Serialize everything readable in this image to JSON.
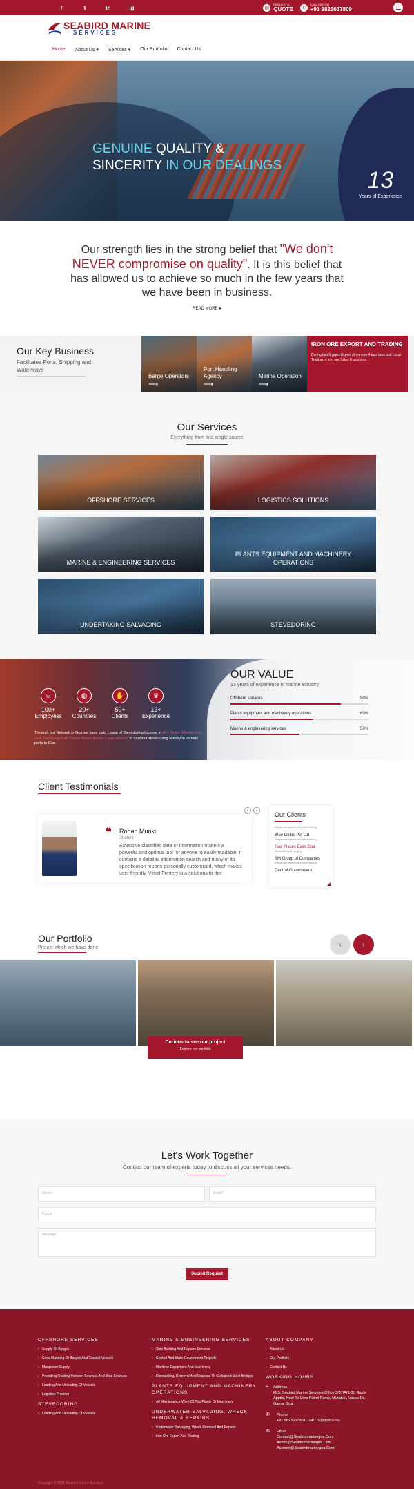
{
  "topbar": {
    "social": [
      "f",
      "t",
      "in",
      "ig"
    ],
    "quote_small": "REQUEST A",
    "quote_big": "QUOTE",
    "call_small": "CALL US NOW",
    "call_big": "+91 9823637809"
  },
  "header": {
    "logo_line1": "SEABIRD MARINE",
    "logo_line2": "SERVICES",
    "nav": [
      "Home",
      "About Us",
      "Services",
      "Our Portfolio",
      "Contact Us"
    ]
  },
  "hero": {
    "line1_a": "GENUINE ",
    "line1_b": "QUALITY &",
    "line2_a": "SINCERITY ",
    "line2_b": "IN OUR DEALINGS",
    "years_num": "13",
    "years_label": "Years of Experience"
  },
  "belief": {
    "p1": "Our strength lies in the strong belief that ",
    "p2": "\"We don't NEVER compromise on quality\"",
    "p3": ". It is this belief that has allowed us to achieve so much in the few years that we have been in business.",
    "read_more": "READ MORE"
  },
  "key_business": {
    "title": "Our Key Business",
    "subtitle": "Facilitates Ports, Shipping and Waterways",
    "tiles": [
      "Barge Operators",
      "Port Handling Agency",
      "Marine Operation"
    ],
    "red_title": "IRON ORE EXPORT AND TRADING",
    "red_text": "During last 5 years Export of iron ore 4 lacs tons and Local Trading of iron ore Sales 8 lacs tons."
  },
  "services": {
    "title": "Our Services",
    "subtitle": "Everything from one single source",
    "items": [
      "OFFSHORE SERVICES",
      "LOGISTICS SOLUTIONS",
      "MARINE & ENGINEERING SERVICES",
      "PLANTS EQUIPMENT AND MACHINERY OPERATIONS",
      "UNDERTAKING SALVAGING",
      "STEVEDORING"
    ]
  },
  "value": {
    "stats": [
      {
        "num": "100+",
        "label": "Employess"
      },
      {
        "num": "20+",
        "label": "Countries"
      },
      {
        "num": "50+",
        "label": "Clients"
      },
      {
        "num": "13+",
        "label": "Experience"
      }
    ],
    "text_a": "Through our Network in Goa we have valid Lease of Stevedoring License in ",
    "text_b": "AKI, Deba, Mhadei  Iron orek  Tiwi  Barge  Lab  Vessel  Mover  Ambia  Cargo Movers",
    "text_c": " to carryout stevedoring activity in various ports in Goa.",
    "title": "OUR VALUE",
    "subtitle": "13 years of experience in marine industry",
    "bars": [
      {
        "label": "Offshore services",
        "pct": "80%",
        "value": 80
      },
      {
        "label": "Plants equipment and machinery operations",
        "pct": "60%",
        "value": 60
      },
      {
        "label": "Marine & engineering services",
        "pct": "50%",
        "value": 50
      }
    ]
  },
  "testimonials": {
    "title": "Client Testimonials",
    "name": "Rohan Munki",
    "role": "Student",
    "text": "Extensive classified data or information make it a powerful and optimal tool for anyone to easily readable. It contains a detailed information search and many of its specification reports personally customised, which makes user-friendly. Vimal Printery is a solutions to this",
    "clients_title": "Our Clients",
    "clients": [
      {
        "name": "",
        "sub": "Barge management & stevedoring"
      },
      {
        "name": "Blue Globe Pvt Ltd",
        "sub": "Barge management & stevedoring"
      },
      {
        "name": "Goa Pisces Exim Goa",
        "sub": "Stevedoring & barging"
      },
      {
        "name": "SM Group of Companies",
        "sub": "Barge management & stevedoring"
      },
      {
        "name": "Central Government",
        "sub": ""
      }
    ]
  },
  "portfolio": {
    "title": "Our Portfolio",
    "subtitle": "Project which we have done",
    "cta_title": "Curious to see our project",
    "cta_sub": "Explore our portfolio"
  },
  "contact": {
    "title": "Let's Work Together",
    "subtitle": "Contact our team of experts today to discuss all your services needs.",
    "name_ph": "Name*",
    "email_ph": "Email*",
    "phone_ph": "Phone",
    "message_ph": "Message",
    "submit": "Submit Request"
  },
  "footer": {
    "col1_h1": "OFFSHORE SERVICES",
    "col1_links": [
      "Supply Of Barges",
      "Crew Manning Of Barges And Coastal Vessels",
      "Manpower Supply",
      "Providing Floating Pontoon Services And Boat Services",
      "Loading And Unloading Of Vessels",
      "Logistics Provider"
    ],
    "col1_h2": "STEVEDORING",
    "col1_links2": [
      "Loading And Unloading Of Vessels"
    ],
    "col2_h1": "MARINE & ENGINEERING SERVICES",
    "col2_links": [
      "Ship Building And Repairs Services",
      "Central And State Government Projects",
      "Maritime Equipment And Machinery",
      "Dismantling, Removal And Disposal Of Collapsed Steel Bridges"
    ],
    "col2_h2": "PLANTS EQUIPMENT AND MACHINERY OPERATIONS",
    "col2_links2": [
      "All Maintenance Work Of The Plants Or Machinery"
    ],
    "col2_h3": "UNDERWATER SALVAGING, WRECK REMOVAL & REPAIRS",
    "col2_links3": [
      "Underwater Salvaging, Wreck Removal And Repairs",
      "Iron Ore Export And Trading"
    ],
    "col3_h1": "ABOUT COMPANY",
    "col3_links": [
      "About Us",
      "Our Portfolio",
      "Contact Us"
    ],
    "col3_h2": "WORKING HOURS",
    "address_label": "Address",
    "address": "M/S. Seabird Marine Services Office 3/87/A(1-3), Rakhi Apptts, Next To Uma Petrol Pump, Mundvel, Vasco-Da-Gama, Goa.",
    "phone_label": "Phone",
    "phone": "+91 9823637809, (24/7 Support Line)",
    "email_label": "Email",
    "email1": "Contact@Seabirdmarinegoa.Com",
    "email2": "Admin@Seabirdmarinegoa.Com",
    "email3": "Account@Seabirdmarinegoa.Com",
    "copyright": "Copyright © 2021 Seabird Marine Services"
  }
}
